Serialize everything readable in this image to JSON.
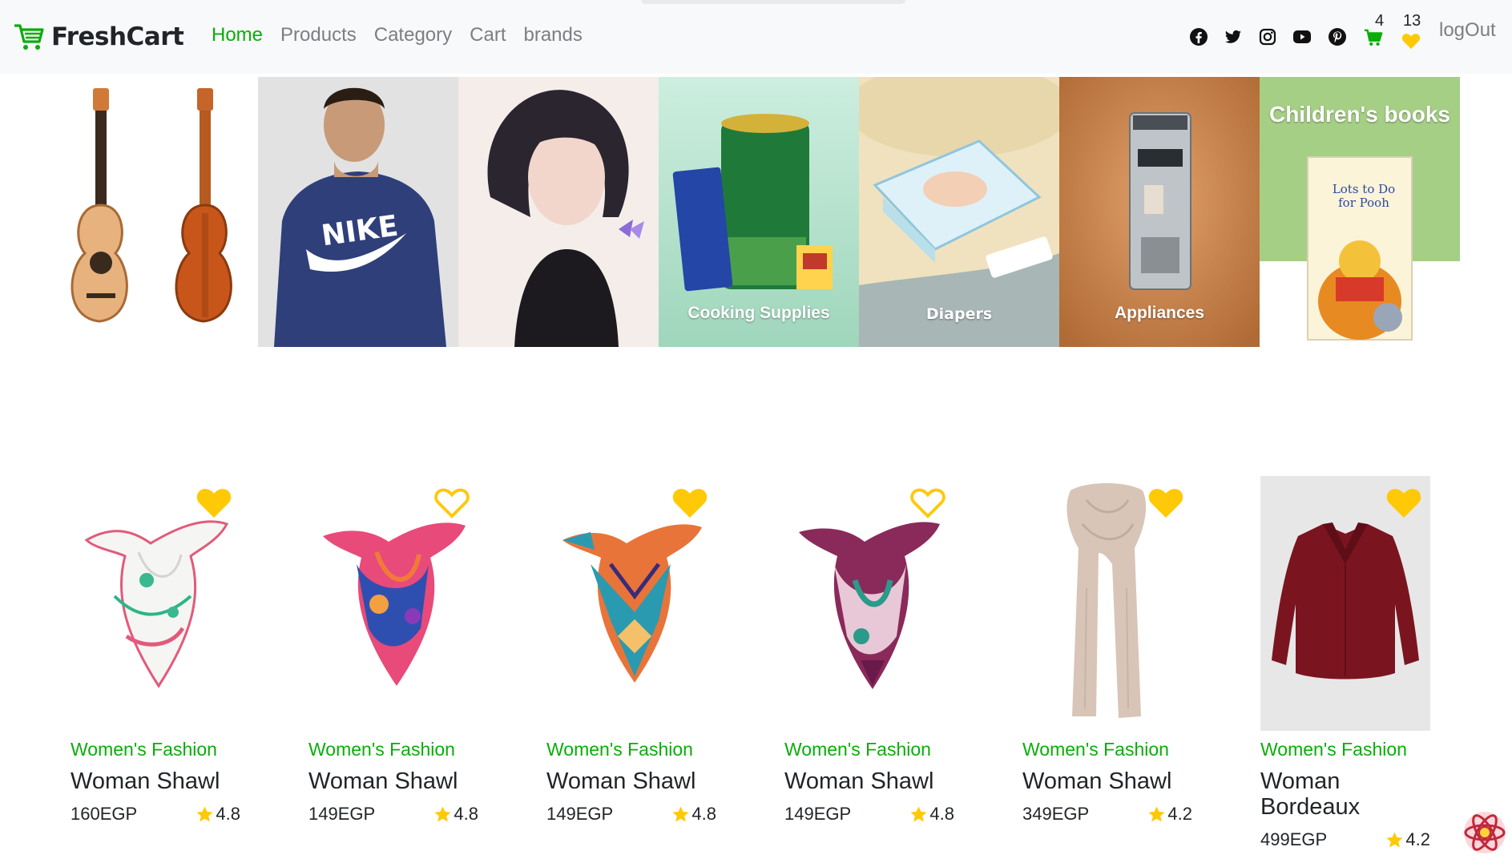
{
  "brand": {
    "name": "FreshCart",
    "color": "#0aad0a"
  },
  "nav": {
    "links": [
      {
        "label": "Home",
        "active": true
      },
      {
        "label": "Products",
        "active": false
      },
      {
        "label": "Category",
        "active": false
      },
      {
        "label": "Cart",
        "active": false
      },
      {
        "label": "brands",
        "active": false
      }
    ]
  },
  "header": {
    "social_icons": [
      "facebook-icon",
      "twitter-icon",
      "instagram-icon",
      "youtube-icon",
      "pinterest-icon"
    ],
    "cart_count": "4",
    "wishlist_count": "13",
    "logout_label": "logOut"
  },
  "slider": {
    "slides": [
      {
        "icon": "guitar-image",
        "label": ""
      },
      {
        "icon": "hoodie-image",
        "label": ""
      },
      {
        "icon": "anime-girl-image",
        "label": ""
      },
      {
        "icon": "cooking-supplies-image",
        "label": "Cooking Supplies"
      },
      {
        "icon": "diapers-image",
        "label": "Diapers"
      },
      {
        "icon": "coffee-machine-image",
        "label": "Appliances"
      },
      {
        "icon": "childrens-books-image",
        "label": "Children's books",
        "book_title": "Lots to Do for Pooh"
      }
    ]
  },
  "products": [
    {
      "category": "Women's Fashion",
      "title": "Woman Shawl",
      "price": "160EGP",
      "rating": "4.8",
      "wishlisted": true,
      "image": "white-floral-scarf"
    },
    {
      "category": "Women's Fashion",
      "title": "Woman Shawl",
      "price": "149EGP",
      "rating": "4.8",
      "wishlisted": false,
      "image": "pink-blue-scarf"
    },
    {
      "category": "Women's Fashion",
      "title": "Woman Shawl",
      "price": "149EGP",
      "rating": "4.8",
      "wishlisted": true,
      "image": "orange-teal-scarf"
    },
    {
      "category": "Women's Fashion",
      "title": "Woman Shawl",
      "price": "149EGP",
      "rating": "4.8",
      "wishlisted": false,
      "image": "plum-scarf"
    },
    {
      "category": "Women's Fashion",
      "title": "Woman Shawl",
      "price": "349EGP",
      "rating": "4.2",
      "wishlisted": true,
      "image": "beige-long-scarf"
    },
    {
      "category": "Women's Fashion",
      "title": "Woman Bordeaux",
      "price": "499EGP",
      "rating": "4.2",
      "wishlisted": true,
      "image": "bordeaux-shirt"
    }
  ],
  "colors": {
    "accent": "#0aad0a",
    "heart": "#ffc908",
    "star": "#ffc908",
    "muted": "#7c7f82"
  }
}
